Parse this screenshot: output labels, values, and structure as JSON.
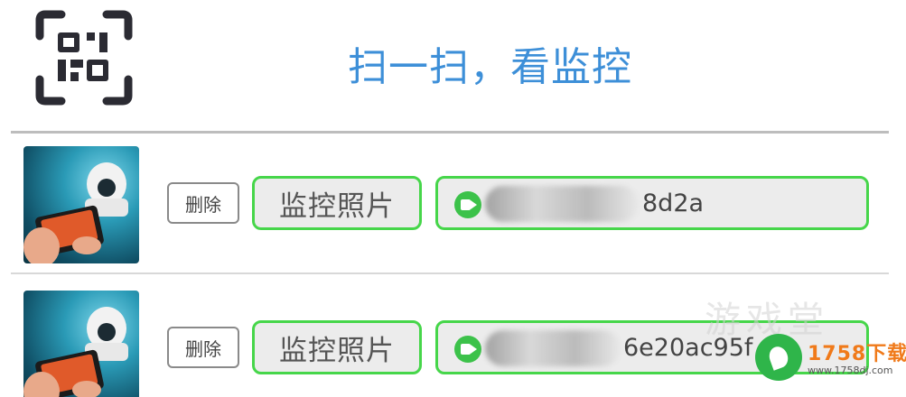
{
  "header": {
    "scan_icon": "qr-scan-icon",
    "title": "扫一扫，看监控"
  },
  "devices": [
    {
      "thumbnail": "camera-thumbnail",
      "delete_label": "删除",
      "photo_label": "监控照片",
      "camera_icon": "video-camera-icon",
      "device_id": "8d2a"
    },
    {
      "thumbnail": "camera-thumbnail",
      "delete_label": "删除",
      "photo_label": "监控照片",
      "camera_icon": "video-camera-icon",
      "device_id": "6e20ac95f"
    }
  ],
  "watermark": {
    "text": "游戏堂",
    "brand": "1758下载",
    "url": "www.1758dj.com"
  },
  "colors": {
    "title": "#3d8fd8",
    "accent_border": "#46d64a",
    "camera_icon": "#3cc24a",
    "watermark_brand": "#f07a1a"
  }
}
